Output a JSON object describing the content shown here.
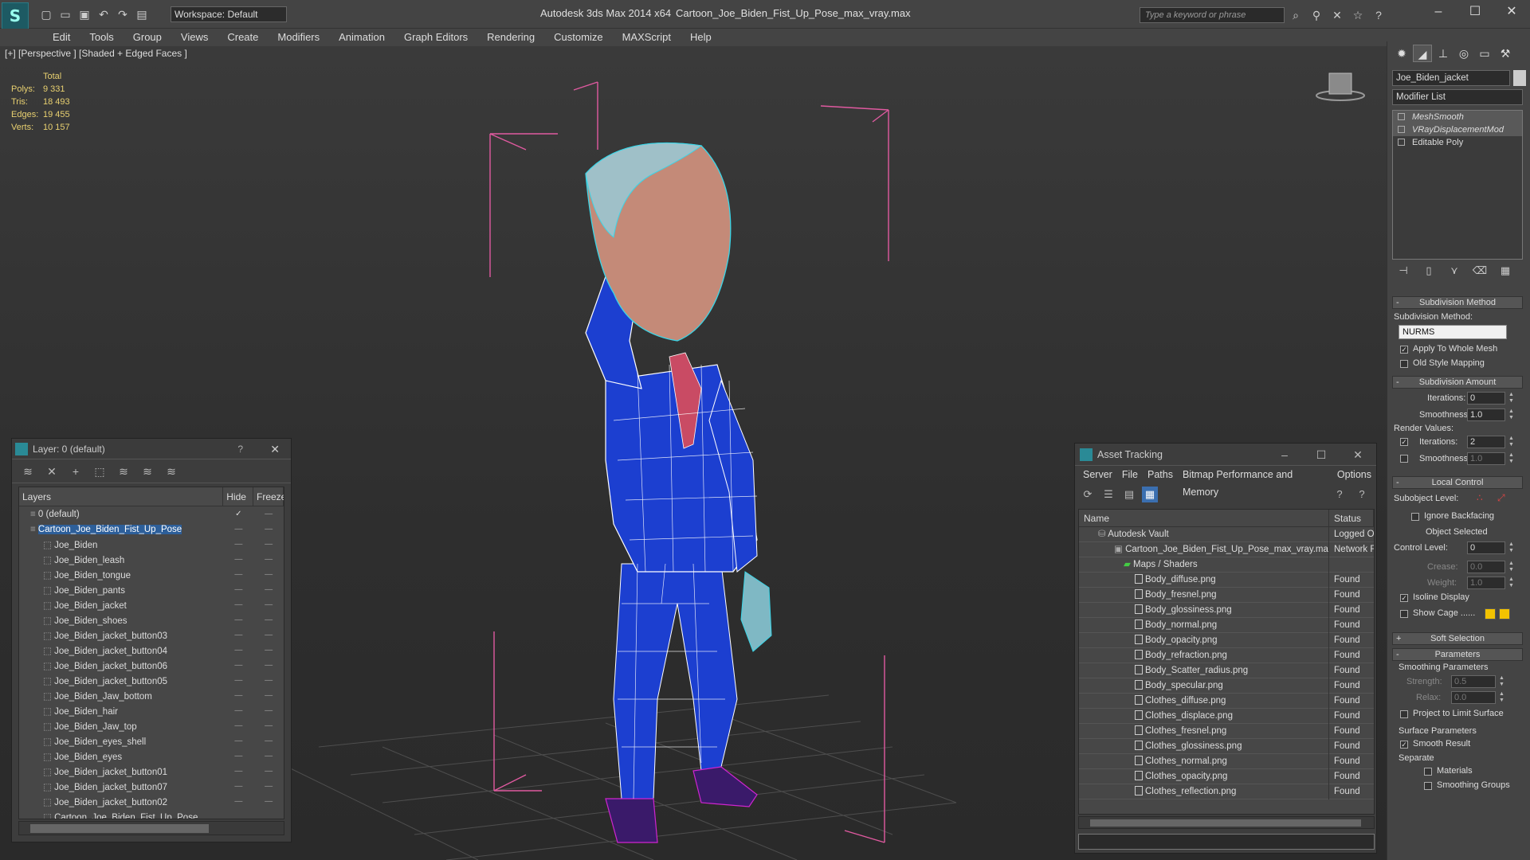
{
  "titlebar": {
    "app_title": "Autodesk 3ds Max  2014 x64",
    "file_name": "Cartoon_Joe_Biden_Fist_Up_Pose_max_vray.max",
    "workspace": "Workspace: Default",
    "search_placeholder": "Type a keyword or phrase"
  },
  "menu": [
    "Edit",
    "Tools",
    "Group",
    "Views",
    "Create",
    "Modifiers",
    "Animation",
    "Graph Editors",
    "Rendering",
    "Customize",
    "MAXScript",
    "Help"
  ],
  "viewport": {
    "label": "[+] [Perspective ] [Shaded + Edged Faces ]",
    "stats": {
      "total_label": "Total",
      "rows": [
        {
          "label": "Polys:",
          "value": "9 331"
        },
        {
          "label": "Tris:",
          "value": "18 493"
        },
        {
          "label": "Edges:",
          "value": "19 455"
        },
        {
          "label": "Verts:",
          "value": "10 157"
        }
      ]
    },
    "colors": {
      "wire": "#ffffff",
      "suit": "#1c3fd0",
      "skin_wire": "#3ad6e8",
      "shoes": "#b020b0",
      "bbox": "#e05aa0",
      "grid": "#4e4e4e"
    }
  },
  "layer_window": {
    "title": "Layer: 0 (default)",
    "help": "?",
    "columns": {
      "name": "Layers",
      "hide": "Hide",
      "freeze": "Freeze"
    },
    "rows": [
      {
        "name": "0 (default)",
        "indent": 1,
        "hide": "",
        "freeze": "—",
        "check": true
      },
      {
        "name": "Cartoon_Joe_Biden_Fist_Up_Pose",
        "indent": 1,
        "selected": true,
        "hide": "—",
        "freeze": "—"
      },
      {
        "name": "Joe_Biden",
        "indent": 2,
        "hide": "—",
        "freeze": "—"
      },
      {
        "name": "Joe_Biden_leash",
        "indent": 2,
        "hide": "—",
        "freeze": "—"
      },
      {
        "name": "Joe_Biden_tongue",
        "indent": 2,
        "hide": "—",
        "freeze": "—"
      },
      {
        "name": "Joe_Biden_pants",
        "indent": 2,
        "hide": "—",
        "freeze": "—"
      },
      {
        "name": "Joe_Biden_jacket",
        "indent": 2,
        "hide": "—",
        "freeze": "—"
      },
      {
        "name": "Joe_Biden_shoes",
        "indent": 2,
        "hide": "—",
        "freeze": "—"
      },
      {
        "name": "Joe_Biden_jacket_button03",
        "indent": 2,
        "hide": "—",
        "freeze": "—"
      },
      {
        "name": "Joe_Biden_jacket_button04",
        "indent": 2,
        "hide": "—",
        "freeze": "—"
      },
      {
        "name": "Joe_Biden_jacket_button06",
        "indent": 2,
        "hide": "—",
        "freeze": "—"
      },
      {
        "name": "Joe_Biden_jacket_button05",
        "indent": 2,
        "hide": "—",
        "freeze": "—"
      },
      {
        "name": "Joe_Biden_Jaw_bottom",
        "indent": 2,
        "hide": "—",
        "freeze": "—"
      },
      {
        "name": "Joe_Biden_hair",
        "indent": 2,
        "hide": "—",
        "freeze": "—"
      },
      {
        "name": "Joe_Biden_Jaw_top",
        "indent": 2,
        "hide": "—",
        "freeze": "—"
      },
      {
        "name": "Joe_Biden_eyes_shell",
        "indent": 2,
        "hide": "—",
        "freeze": "—"
      },
      {
        "name": "Joe_Biden_eyes",
        "indent": 2,
        "hide": "—",
        "freeze": "—"
      },
      {
        "name": "Joe_Biden_jacket_button01",
        "indent": 2,
        "hide": "—",
        "freeze": "—"
      },
      {
        "name": "Joe_Biden_jacket_button07",
        "indent": 2,
        "hide": "—",
        "freeze": "—"
      },
      {
        "name": "Joe_Biden_jacket_button02",
        "indent": 2,
        "hide": "—",
        "freeze": "—"
      },
      {
        "name": "Cartoon_Joe_Biden_Fist_Up_Pose",
        "indent": 2,
        "hide": "",
        "freeze": ""
      }
    ]
  },
  "asset_tracking": {
    "title": "Asset Tracking",
    "menu": [
      "Server",
      "File",
      "Paths",
      "Bitmap Performance and Memory",
      "Options"
    ],
    "columns": {
      "name": "Name",
      "status": "Status"
    },
    "rows": [
      {
        "name": "Autodesk Vault",
        "status": "Logged O",
        "indent": 0
      },
      {
        "name": "Cartoon_Joe_Biden_Fist_Up_Pose_max_vray.max",
        "status": "Network F",
        "indent": 1
      },
      {
        "name": "Maps / Shaders",
        "status": "",
        "indent": 2
      },
      {
        "name": "Body_diffuse.png",
        "status": "Found",
        "indent": 3
      },
      {
        "name": "Body_fresnel.png",
        "status": "Found",
        "indent": 3
      },
      {
        "name": "Body_glossiness.png",
        "status": "Found",
        "indent": 3
      },
      {
        "name": "Body_normal.png",
        "status": "Found",
        "indent": 3
      },
      {
        "name": "Body_opacity.png",
        "status": "Found",
        "indent": 3
      },
      {
        "name": "Body_refraction.png",
        "status": "Found",
        "indent": 3
      },
      {
        "name": "Body_Scatter_radius.png",
        "status": "Found",
        "indent": 3
      },
      {
        "name": "Body_specular.png",
        "status": "Found",
        "indent": 3
      },
      {
        "name": "Clothes_diffuse.png",
        "status": "Found",
        "indent": 3
      },
      {
        "name": "Clothes_displace.png",
        "status": "Found",
        "indent": 3
      },
      {
        "name": "Clothes_fresnel.png",
        "status": "Found",
        "indent": 3
      },
      {
        "name": "Clothes_glossiness.png",
        "status": "Found",
        "indent": 3
      },
      {
        "name": "Clothes_normal.png",
        "status": "Found",
        "indent": 3
      },
      {
        "name": "Clothes_opacity.png",
        "status": "Found",
        "indent": 3
      },
      {
        "name": "Clothes_reflection.png",
        "status": "Found",
        "indent": 3
      }
    ]
  },
  "command_panel": {
    "object_name": "Joe_Biden_jacket",
    "modifier_list": "Modifier List",
    "stack": [
      {
        "name": "MeshSmooth",
        "italic": true,
        "highlight": true
      },
      {
        "name": "VRayDisplacementMod",
        "italic": true,
        "highlight": true
      },
      {
        "name": "Editable Poly",
        "italic": false,
        "highlight": false
      }
    ],
    "subdivision_method": {
      "header": "Subdivision Method",
      "label": "Subdivision Method:",
      "value": "NURMS",
      "apply_whole": "Apply To Whole Mesh",
      "old_style": "Old Style Mapping"
    },
    "subdivision_amount": {
      "header": "Subdivision Amount",
      "iterations_label": "Iterations:",
      "iterations": "0",
      "smoothness_label": "Smoothness:",
      "smoothness": "1.0",
      "render_values": "Render Values:",
      "r_iterations_label": "Iterations:",
      "r_iterations": "2",
      "r_smoothness_label": "Smoothness:",
      "r_smoothness": "1.0"
    },
    "local_control": {
      "header": "Local Control",
      "subobject": "Subobject Level:",
      "ignore_backfacing": "Ignore Backfacing",
      "object_selected": "Object Selected",
      "control_level_label": "Control Level:",
      "control_level": "0",
      "crease_label": "Crease:",
      "crease": "0.0",
      "weight_label": "Weight:",
      "weight": "1.0",
      "isoline": "Isoline Display",
      "show_cage": "Show Cage ......"
    },
    "soft_selection": "Soft Selection",
    "parameters": {
      "header": "Parameters",
      "smoothing": "Smoothing Parameters",
      "strength_label": "Strength:",
      "strength": "0.5",
      "relax_label": "Relax:",
      "relax": "0.0",
      "project": "Project to Limit Surface",
      "surface": "Surface Parameters",
      "smooth_result": "Smooth Result",
      "separate": "Separate",
      "materials": "Materials",
      "smoothing_groups": "Smoothing Groups"
    }
  }
}
